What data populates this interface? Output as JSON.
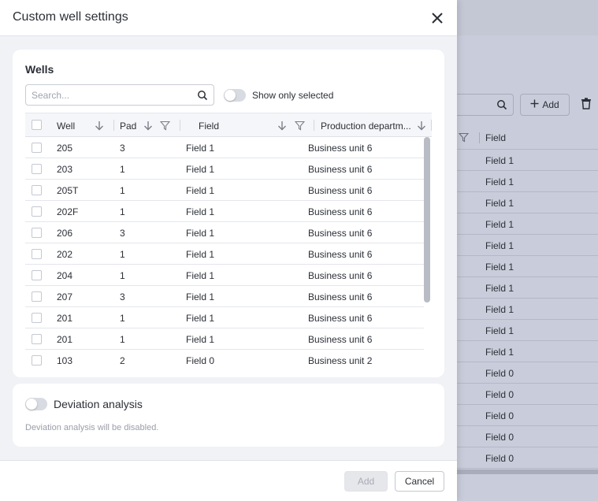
{
  "background": {
    "add_button_label": "Add",
    "field_header": "Field",
    "field_values": [
      "Field 1",
      "Field 1",
      "Field 1",
      "Field 1",
      "Field 1",
      "Field 1",
      "Field 1",
      "Field 1",
      "Field 1",
      "Field 1",
      "Field 0",
      "Field 0",
      "Field 0",
      "Field 0",
      "Field 0"
    ]
  },
  "dialog": {
    "title": "Custom well settings",
    "wells_card": {
      "title": "Wells",
      "search_placeholder": "Search...",
      "show_only_selected_label": "Show only selected",
      "show_only_selected_on": false,
      "columns": {
        "well": "Well",
        "pad": "Pad",
        "field": "Field",
        "production_department": "Production departm..."
      },
      "rows": [
        {
          "well": "205",
          "pad": "3",
          "field": "Field 1",
          "production_department": "Business unit 6"
        },
        {
          "well": "203",
          "pad": "1",
          "field": "Field 1",
          "production_department": "Business unit 6"
        },
        {
          "well": "205T",
          "pad": "1",
          "field": "Field 1",
          "production_department": "Business unit 6"
        },
        {
          "well": "202F",
          "pad": "1",
          "field": "Field 1",
          "production_department": "Business unit 6"
        },
        {
          "well": "206",
          "pad": "3",
          "field": "Field 1",
          "production_department": "Business unit 6"
        },
        {
          "well": "202",
          "pad": "1",
          "field": "Field 1",
          "production_department": "Business unit 6"
        },
        {
          "well": "204",
          "pad": "1",
          "field": "Field 1",
          "production_department": "Business unit 6"
        },
        {
          "well": "207",
          "pad": "3",
          "field": "Field 1",
          "production_department": "Business unit 6"
        },
        {
          "well": "201",
          "pad": "1",
          "field": "Field 1",
          "production_department": "Business unit 6"
        },
        {
          "well": "201",
          "pad": "1",
          "field": "Field 1",
          "production_department": "Business unit 6"
        },
        {
          "well": "103",
          "pad": "2",
          "field": "Field 0",
          "production_department": "Business unit 2"
        }
      ]
    },
    "deviation_card": {
      "label": "Deviation analysis",
      "enabled": false,
      "note": "Deviation analysis will be disabled."
    },
    "footer": {
      "add_label": "Add",
      "cancel_label": "Cancel"
    }
  }
}
